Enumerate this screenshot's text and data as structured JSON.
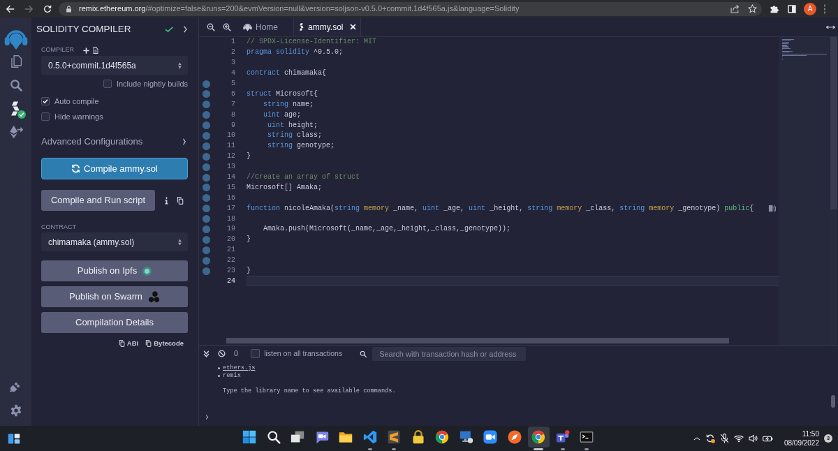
{
  "browser": {
    "nav": [
      {
        "kind": "back",
        "disabled": false
      },
      {
        "kind": "forward",
        "disabled": true
      },
      {
        "kind": "reload",
        "disabled": false
      }
    ],
    "address": {
      "host": "remix.ethereum.org",
      "path": "/#optimize=false&runs=200&evmVersion=null&version=soljson-v0.5.0+commit.1d4f565a.js&language=Solidity"
    },
    "profile_initial": "A"
  },
  "icon_panel": {
    "items": [
      {
        "kind": "files",
        "selected": false
      },
      {
        "kind": "search",
        "selected": false
      },
      {
        "kind": "compiler",
        "selected": true,
        "status_ok": true
      },
      {
        "kind": "deploy",
        "selected": false
      }
    ],
    "bottom_items": [
      {
        "kind": "plugin",
        "selected": false
      },
      {
        "kind": "settings",
        "selected": false
      }
    ]
  },
  "side_panel": {
    "title": "SOLIDITY COMPILER",
    "compiled": true,
    "compiler_label": "COMPILER",
    "compiler_version": "0.5.0+commit.1d4f565a",
    "nightly": {
      "label": "Include nightly builds",
      "checked": false
    },
    "options": [
      {
        "label": "Auto compile",
        "checked": true
      },
      {
        "label": "Hide warnings",
        "checked": false
      }
    ],
    "advanced": {
      "label": "Advanced Configurations",
      "expanded": false
    },
    "compile_button": "Compile ammy.sol",
    "run_button": "Compile and Run script",
    "contract_label": "CONTRACT",
    "contract": "chimamaka (ammy.sol)",
    "actions": [
      {
        "label": "Publish on Ipfs",
        "kind": "ipfs"
      },
      {
        "label": "Publish on Swarm",
        "kind": "swarm"
      },
      {
        "label": "Compilation Details",
        "kind": "details"
      }
    ],
    "copy_links": [
      "ABI",
      "Bytecode"
    ]
  },
  "editor": {
    "tabs": [
      {
        "label": "Home",
        "kind": "home",
        "selected": false
      },
      {
        "label": "ammy.sol",
        "kind": "solidity",
        "selected": true
      }
    ],
    "lines": [
      {
        "number": "1",
        "dot": false,
        "current": false,
        "tokens": [
          {
            "kind": "comment",
            "text": "// SPDX-License-Identifier: MIT"
          }
        ]
      },
      {
        "number": "2",
        "dot": false,
        "current": false,
        "tokens": [
          {
            "kind": "keyword",
            "text": "pragma"
          },
          {
            "kind": "keyword",
            "text": " solidity"
          },
          {
            "kind": "plain",
            "text": " ^0.5.0;"
          }
        ]
      },
      {
        "number": "3",
        "dot": false,
        "current": false
      },
      {
        "number": "4",
        "dot": false,
        "current": false,
        "tokens": [
          {
            "kind": "keyword",
            "text": "contract"
          },
          {
            "kind": "plain",
            "text": " chimamaka{"
          }
        ]
      },
      {
        "number": "5",
        "dot": true,
        "current": false
      },
      {
        "number": "6",
        "dot": true,
        "current": false,
        "tokens": [
          {
            "kind": "keyword",
            "text": "struct"
          },
          {
            "kind": "plain",
            "text": " Microsoft{"
          }
        ]
      },
      {
        "number": "7",
        "dot": true,
        "current": false,
        "tokens": [
          {
            "kind": "keyword",
            "text": "    string"
          },
          {
            "kind": "plain",
            "text": " name;"
          }
        ]
      },
      {
        "number": "8",
        "dot": true,
        "current": false,
        "tokens": [
          {
            "kind": "keyword",
            "text": "    uint"
          },
          {
            "kind": "plain",
            "text": " age;"
          }
        ]
      },
      {
        "number": "9",
        "dot": true,
        "current": false,
        "tokens": [
          {
            "kind": "keyword",
            "text": "     uint"
          },
          {
            "kind": "plain",
            "text": " height;"
          }
        ]
      },
      {
        "number": "10",
        "dot": true,
        "current": false,
        "tokens": [
          {
            "kind": "keyword",
            "text": "     string"
          },
          {
            "kind": "plain",
            "text": " class;"
          }
        ]
      },
      {
        "number": "11",
        "dot": true,
        "current": false,
        "tokens": [
          {
            "kind": "keyword",
            "text": "     string"
          },
          {
            "kind": "plain",
            "text": " genotype;"
          }
        ]
      },
      {
        "number": "12",
        "dot": true,
        "current": false,
        "tokens": [
          {
            "kind": "plain",
            "text": "}"
          }
        ]
      },
      {
        "number": "13",
        "dot": true,
        "current": false
      },
      {
        "number": "14",
        "dot": true,
        "current": false,
        "tokens": [
          {
            "kind": "comment",
            "text": "//Create an array of struct"
          }
        ]
      },
      {
        "number": "15",
        "dot": true,
        "current": false,
        "tokens": [
          {
            "kind": "plain",
            "text": "Microsoft[] Amaka;"
          }
        ]
      },
      {
        "number": "16",
        "dot": true,
        "current": false
      },
      {
        "number": "17",
        "dot": true,
        "current": false,
        "gas": true,
        "tokens": [
          {
            "kind": "keyword",
            "text": "function"
          },
          {
            "kind": "plain",
            "text": " nicoleAmaka("
          },
          {
            "kind": "keyword",
            "text": "string"
          },
          {
            "kind": "storage",
            "text": " memory"
          },
          {
            "kind": "plain",
            "text": " _name, "
          },
          {
            "kind": "keyword",
            "text": "uint"
          },
          {
            "kind": "plain",
            "text": " _age, "
          },
          {
            "kind": "keyword",
            "text": "uint"
          },
          {
            "kind": "plain",
            "text": " _height, "
          },
          {
            "kind": "keyword",
            "text": "string"
          },
          {
            "kind": "storage",
            "text": " memory"
          },
          {
            "kind": "plain",
            "text": " _class, "
          },
          {
            "kind": "keyword",
            "text": "string"
          },
          {
            "kind": "storage",
            "text": " memory"
          },
          {
            "kind": "plain",
            "text": " _genotype) "
          },
          {
            "kind": "modifier",
            "text": "public"
          },
          {
            "kind": "plain",
            "text": "{"
          }
        ]
      },
      {
        "number": "18",
        "dot": true,
        "current": false
      },
      {
        "number": "19",
        "dot": true,
        "current": false,
        "tokens": [
          {
            "kind": "plain",
            "text": "    Amaka.push(Microsoft(_name,_age,_height,_class,_genotype));"
          }
        ]
      },
      {
        "number": "20",
        "dot": true,
        "current": false,
        "tokens": [
          {
            "kind": "plain",
            "text": "}"
          }
        ]
      },
      {
        "number": "21",
        "dot": true,
        "current": false
      },
      {
        "number": "22",
        "dot": true,
        "current": false
      },
      {
        "number": "23",
        "dot": true,
        "current": false,
        "tokens": [
          {
            "kind": "plain",
            "text": "}"
          }
        ]
      },
      {
        "number": "24",
        "dot": false,
        "current": true
      }
    ]
  },
  "terminal": {
    "pending_count": "0",
    "listen": {
      "label": "listen on all transactions",
      "checked": false
    },
    "search": {
      "placeholder": "Search with transaction hash or address"
    },
    "output": [
      {
        "kind": "link_item",
        "text": "ethers.js"
      },
      {
        "kind": "item",
        "text": "remix"
      },
      {
        "kind": "message",
        "text": "Type the library name to see available commands."
      }
    ]
  },
  "taskbar": {
    "apps": [
      {
        "kind": "start",
        "running": false,
        "selected": false
      },
      {
        "kind": "search",
        "running": false,
        "selected": false
      },
      {
        "kind": "task_view",
        "running": false,
        "selected": false
      },
      {
        "kind": "chat",
        "running": false,
        "selected": false
      },
      {
        "kind": "folder",
        "running": false,
        "selected": false
      },
      {
        "kind": "vscode",
        "running": true,
        "selected": false
      },
      {
        "kind": "sublime",
        "running": true,
        "selected": false
      },
      {
        "kind": "lock",
        "running": false,
        "selected": false
      },
      {
        "kind": "chrome",
        "running": false,
        "selected": false
      },
      {
        "kind": "remote",
        "running": false,
        "selected": false
      },
      {
        "kind": "zoom",
        "running": false,
        "selected": false
      },
      {
        "kind": "compass",
        "running": false,
        "selected": false
      },
      {
        "kind": "chrome",
        "running": true,
        "selected": true
      },
      {
        "kind": "teams",
        "running": true,
        "selected": false
      },
      {
        "kind": "terminal",
        "running": true,
        "selected": false
      }
    ],
    "tray": [
      {
        "kind": "chevron"
      },
      {
        "kind": "sync"
      },
      {
        "kind": "mic_muted"
      },
      {
        "kind": "wifi"
      },
      {
        "kind": "volume"
      },
      {
        "kind": "battery"
      }
    ],
    "time": "11:50",
    "date": "08/09/2022",
    "notifications": "3"
  }
}
